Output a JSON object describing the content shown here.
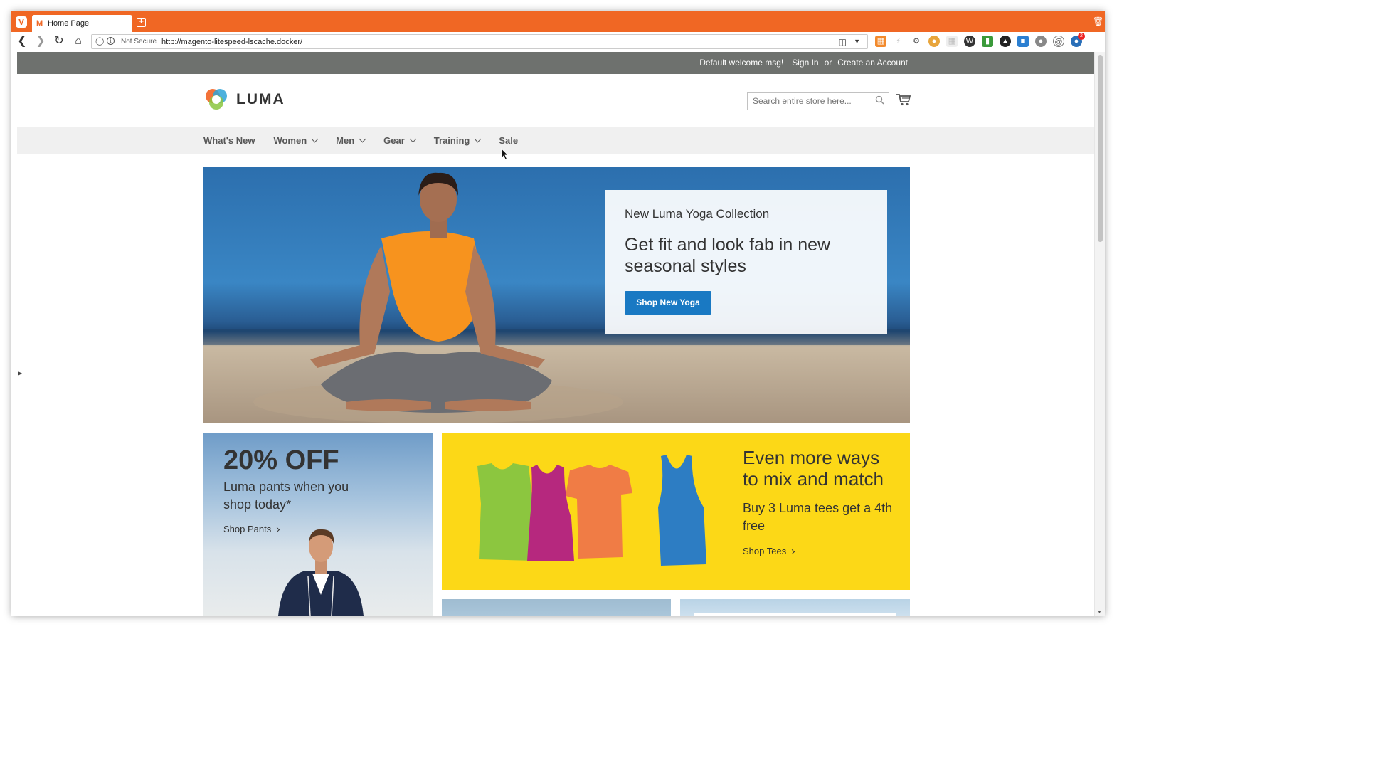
{
  "browser": {
    "tab_title": "Home Page",
    "not_secure": "Not Secure",
    "url": "http://magento-litespeed-lscache.docker/",
    "extension_badge_count": "2"
  },
  "panel": {
    "welcome": "Default welcome msg!",
    "sign_in": "Sign In",
    "or": "or",
    "create_account": "Create an Account"
  },
  "header": {
    "logo_text": "LUMA",
    "search_placeholder": "Search entire store here..."
  },
  "nav": {
    "items": [
      {
        "label": "What's New",
        "has_submenu": false
      },
      {
        "label": "Women",
        "has_submenu": true
      },
      {
        "label": "Men",
        "has_submenu": true
      },
      {
        "label": "Gear",
        "has_submenu": true
      },
      {
        "label": "Training",
        "has_submenu": true
      },
      {
        "label": "Sale",
        "has_submenu": false
      }
    ]
  },
  "hero": {
    "kicker": "New Luma Yoga Collection",
    "title": "Get fit and look fab in new seasonal styles",
    "button": "Shop New Yoga"
  },
  "pants_block": {
    "title": "20% OFF",
    "text": "Luma pants when you shop today*",
    "link": "Shop Pants"
  },
  "tees_block": {
    "title": "Even more ways to mix and match",
    "text": "Buy 3 Luma tees get a 4th free",
    "link": "Shop Tees"
  },
  "colors": {
    "browser_accent": "#f06724",
    "panel_bg": "#6e716e",
    "nav_bg": "#f0f0f0",
    "primary_button": "#1979c3",
    "tees_bg": "#fcd817"
  }
}
